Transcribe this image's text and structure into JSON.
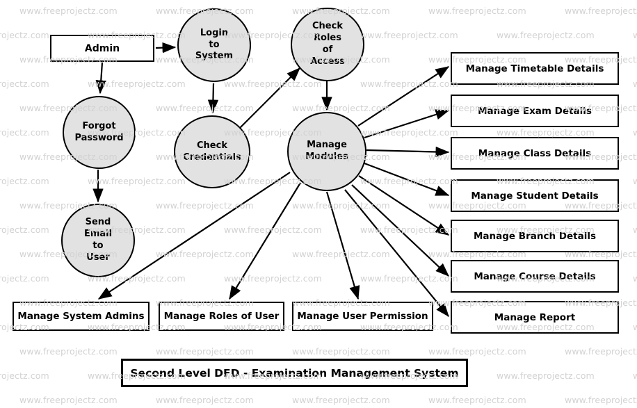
{
  "diagram": {
    "title": "Second Level DFD - Examination Management System",
    "watermark_text": "www.freeprojectz.com",
    "colors": {
      "process_fill": "#e2e2e2",
      "stroke": "#000000",
      "background": "#ffffff",
      "watermark": "#d2d2d2"
    }
  },
  "entities": {
    "admin": "Admin"
  },
  "processes": {
    "login_to_system": "Login\nto\nSystem",
    "check_roles_of_access": "Check\nRoles\nof\nAccess",
    "forgot_password": "Forgot\nPassword",
    "check_credentials": "Check\nCredentials",
    "manage_modules": "Manage\nModules",
    "send_email_to_user": "Send\nEmail\nto\nUser"
  },
  "right_modules": [
    "Manage Timetable Details",
    "Manage Exam Details",
    "Manage Class Details",
    "Manage Student Details",
    "Manage Branch Details",
    "Manage Course Details",
    "Manage Report"
  ],
  "bottom_modules": [
    "Manage System Admins",
    "Manage Roles of User",
    "Manage User Permission"
  ]
}
